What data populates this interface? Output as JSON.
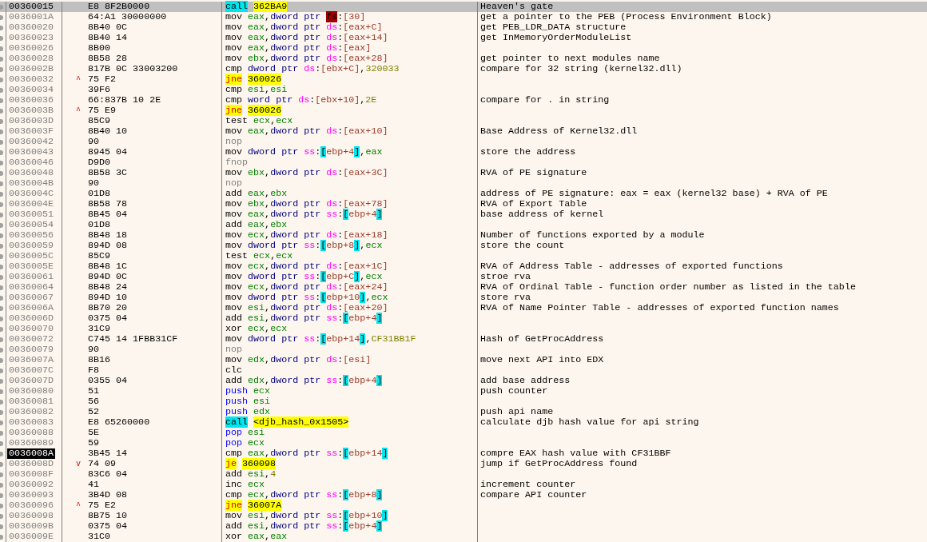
{
  "rows": [
    {
      "address": "00360015",
      "bytes": "E8 8F2B0000",
      "selected": true,
      "current": false,
      "mnemonic": {
        "kind": "call",
        "text": "call"
      },
      "operands": [
        {
          "kind": "target",
          "text": "362BA9"
        }
      ],
      "comment": "Heaven's gate"
    },
    {
      "address": "0036001A",
      "bytes": "64:A1 30000000",
      "selected": false,
      "current": false,
      "mnemonic": {
        "kind": "plain",
        "text": "mov"
      },
      "operands": [
        {
          "kind": "reg",
          "text": "eax"
        },
        {
          "kind": "punct",
          "text": ","
        },
        {
          "kind": "size",
          "text": "dword ptr"
        },
        {
          "kind": "seg_alert",
          "text": "fs"
        },
        {
          "kind": "punct",
          "text": ":"
        },
        {
          "kind": "mem",
          "text": "[30]"
        }
      ],
      "comment": "get a pointer to the PEB (Process Environment Block)"
    },
    {
      "address": "00360020",
      "bytes": "8B40 0C",
      "selected": false,
      "current": false,
      "mnemonic": {
        "kind": "plain",
        "text": "mov"
      },
      "operands": [
        {
          "kind": "reg",
          "text": "eax"
        },
        {
          "kind": "punct",
          "text": ","
        },
        {
          "kind": "size",
          "text": "dword ptr"
        },
        {
          "kind": "seg",
          "text": "ds"
        },
        {
          "kind": "punct",
          "text": ":"
        },
        {
          "kind": "mem",
          "text": "[eax+C]"
        }
      ],
      "comment": "get PEB_LDR_DATA structure"
    },
    {
      "address": "00360023",
      "bytes": "8B40 14",
      "selected": false,
      "current": false,
      "mnemonic": {
        "kind": "plain",
        "text": "mov"
      },
      "operands": [
        {
          "kind": "reg",
          "text": "eax"
        },
        {
          "kind": "punct",
          "text": ","
        },
        {
          "kind": "size",
          "text": "dword ptr"
        },
        {
          "kind": "seg",
          "text": "ds"
        },
        {
          "kind": "punct",
          "text": ":"
        },
        {
          "kind": "mem",
          "text": "[eax+14]"
        }
      ],
      "comment": "get InMemoryOrderModuleList"
    },
    {
      "address": "00360026",
      "bytes": "8B00",
      "selected": false,
      "current": false,
      "mnemonic": {
        "kind": "plain",
        "text": "mov"
      },
      "operands": [
        {
          "kind": "reg",
          "text": "eax"
        },
        {
          "kind": "punct",
          "text": ","
        },
        {
          "kind": "size",
          "text": "dword ptr"
        },
        {
          "kind": "seg",
          "text": "ds"
        },
        {
          "kind": "punct",
          "text": ":"
        },
        {
          "kind": "mem",
          "text": "[eax]"
        }
      ]
    },
    {
      "address": "00360028",
      "bytes": "8B58 28",
      "selected": false,
      "current": false,
      "mnemonic": {
        "kind": "plain",
        "text": "mov"
      },
      "operands": [
        {
          "kind": "reg",
          "text": "ebx"
        },
        {
          "kind": "punct",
          "text": ","
        },
        {
          "kind": "size",
          "text": "dword ptr"
        },
        {
          "kind": "seg",
          "text": "ds"
        },
        {
          "kind": "punct",
          "text": ":"
        },
        {
          "kind": "mem",
          "text": "[eax+28]"
        }
      ],
      "comment": "get pointer to next modules name"
    },
    {
      "address": "0036002B",
      "bytes": "817B 0C 33003200",
      "selected": false,
      "current": false,
      "mnemonic": {
        "kind": "plain",
        "text": "cmp"
      },
      "operands": [
        {
          "kind": "size",
          "text": "dword ptr"
        },
        {
          "kind": "seg",
          "text": "ds"
        },
        {
          "kind": "punct",
          "text": ":"
        },
        {
          "kind": "mem",
          "text": "[ebx+C]"
        },
        {
          "kind": "punct",
          "text": ","
        },
        {
          "kind": "imm",
          "text": "320033"
        }
      ],
      "comment": "compare for 32 string (kernel32.dll)"
    },
    {
      "address": "00360032",
      "arrow": "^",
      "bytes": "75 F2",
      "selected": false,
      "current": false,
      "mnemonic": {
        "kind": "jump",
        "text": "jne"
      },
      "operands": [
        {
          "kind": "target",
          "text": "360026"
        }
      ]
    },
    {
      "address": "00360034",
      "bytes": "39F6",
      "selected": false,
      "current": false,
      "mnemonic": {
        "kind": "plain",
        "text": "cmp"
      },
      "operands": [
        {
          "kind": "reg",
          "text": "esi"
        },
        {
          "kind": "punct",
          "text": ","
        },
        {
          "kind": "reg",
          "text": "esi"
        }
      ]
    },
    {
      "address": "00360036",
      "bytes": "66:837B 10 2E",
      "selected": false,
      "current": false,
      "mnemonic": {
        "kind": "plain",
        "text": "cmp"
      },
      "operands": [
        {
          "kind": "size",
          "text": "word ptr"
        },
        {
          "kind": "seg",
          "text": "ds"
        },
        {
          "kind": "punct",
          "text": ":"
        },
        {
          "kind": "mem",
          "text": "[ebx+10]"
        },
        {
          "kind": "punct",
          "text": ","
        },
        {
          "kind": "imm",
          "text": "2E"
        }
      ],
      "comment": "compare for . in string"
    },
    {
      "address": "0036003B",
      "arrow": "^",
      "bytes": "75 E9",
      "selected": false,
      "current": false,
      "mnemonic": {
        "kind": "jump",
        "text": "jne"
      },
      "operands": [
        {
          "kind": "target",
          "text": "360026"
        }
      ]
    },
    {
      "address": "0036003D",
      "bytes": "85C9",
      "selected": false,
      "current": false,
      "mnemonic": {
        "kind": "plain",
        "text": "test"
      },
      "operands": [
        {
          "kind": "reg",
          "text": "ecx"
        },
        {
          "kind": "punct",
          "text": ","
        },
        {
          "kind": "reg",
          "text": "ecx"
        }
      ]
    },
    {
      "address": "0036003F",
      "bytes": "8B40 10",
      "selected": false,
      "current": false,
      "mnemonic": {
        "kind": "plain",
        "text": "mov"
      },
      "operands": [
        {
          "kind": "reg",
          "text": "eax"
        },
        {
          "kind": "punct",
          "text": ","
        },
        {
          "kind": "size",
          "text": "dword ptr"
        },
        {
          "kind": "seg",
          "text": "ds"
        },
        {
          "kind": "punct",
          "text": ":"
        },
        {
          "kind": "mem",
          "text": "[eax+10]"
        }
      ],
      "comment": "Base Address of Kernel32.dll"
    },
    {
      "address": "00360042",
      "bytes": "90",
      "selected": false,
      "current": false,
      "mnemonic": {
        "kind": "nop",
        "text": "nop"
      },
      "operands": []
    },
    {
      "address": "00360043",
      "bytes": "8945 04",
      "selected": false,
      "current": false,
      "mnemonic": {
        "kind": "plain",
        "text": "mov"
      },
      "operands": [
        {
          "kind": "size",
          "text": "dword ptr"
        },
        {
          "kind": "seg",
          "text": "ss"
        },
        {
          "kind": "punct",
          "text": ":"
        },
        {
          "kind": "bracket",
          "text": "["
        },
        {
          "kind": "mem",
          "text": "ebp+4"
        },
        {
          "kind": "bracket",
          "text": "]"
        },
        {
          "kind": "punct",
          "text": ","
        },
        {
          "kind": "reg",
          "text": "eax"
        }
      ],
      "comment": "store the address"
    },
    {
      "address": "00360046",
      "bytes": "D9D0",
      "selected": false,
      "current": false,
      "mnemonic": {
        "kind": "nop",
        "text": "fnop"
      },
      "operands": []
    },
    {
      "address": "00360048",
      "bytes": "8B58 3C",
      "selected": false,
      "current": false,
      "mnemonic": {
        "kind": "plain",
        "text": "mov"
      },
      "operands": [
        {
          "kind": "reg",
          "text": "ebx"
        },
        {
          "kind": "punct",
          "text": ","
        },
        {
          "kind": "size",
          "text": "dword ptr"
        },
        {
          "kind": "seg",
          "text": "ds"
        },
        {
          "kind": "punct",
          "text": ":"
        },
        {
          "kind": "mem",
          "text": "[eax+3C]"
        }
      ],
      "comment": "RVA of PE signature"
    },
    {
      "address": "0036004B",
      "bytes": "90",
      "selected": false,
      "current": false,
      "mnemonic": {
        "kind": "nop",
        "text": "nop"
      },
      "operands": []
    },
    {
      "address": "0036004C",
      "bytes": "01D8",
      "selected": false,
      "current": false,
      "mnemonic": {
        "kind": "plain",
        "text": "add"
      },
      "operands": [
        {
          "kind": "reg",
          "text": "eax"
        },
        {
          "kind": "punct",
          "text": ","
        },
        {
          "kind": "reg",
          "text": "ebx"
        }
      ],
      "comment": "address of PE signature: eax = eax (kernel32 base) + RVA of PE"
    },
    {
      "address": "0036004E",
      "bytes": "8B58 78",
      "selected": false,
      "current": false,
      "mnemonic": {
        "kind": "plain",
        "text": "mov"
      },
      "operands": [
        {
          "kind": "reg",
          "text": "ebx"
        },
        {
          "kind": "punct",
          "text": ","
        },
        {
          "kind": "size",
          "text": "dword ptr"
        },
        {
          "kind": "seg",
          "text": "ds"
        },
        {
          "kind": "punct",
          "text": ":"
        },
        {
          "kind": "mem",
          "text": "[eax+78]"
        }
      ],
      "comment": "RVA of Export Table"
    },
    {
      "address": "00360051",
      "bytes": "8B45 04",
      "selected": false,
      "current": false,
      "mnemonic": {
        "kind": "plain",
        "text": "mov"
      },
      "operands": [
        {
          "kind": "reg",
          "text": "eax"
        },
        {
          "kind": "punct",
          "text": ","
        },
        {
          "kind": "size",
          "text": "dword ptr"
        },
        {
          "kind": "seg",
          "text": "ss"
        },
        {
          "kind": "punct",
          "text": ":"
        },
        {
          "kind": "bracket",
          "text": "["
        },
        {
          "kind": "mem",
          "text": "ebp+4"
        },
        {
          "kind": "bracket",
          "text": "]"
        }
      ],
      "comment": "base address of kernel"
    },
    {
      "address": "00360054",
      "bytes": "01D8",
      "selected": false,
      "current": false,
      "mnemonic": {
        "kind": "plain",
        "text": "add"
      },
      "operands": [
        {
          "kind": "reg",
          "text": "eax"
        },
        {
          "kind": "punct",
          "text": ","
        },
        {
          "kind": "reg",
          "text": "ebx"
        }
      ]
    },
    {
      "address": "00360056",
      "bytes": "8B48 18",
      "selected": false,
      "current": false,
      "mnemonic": {
        "kind": "plain",
        "text": "mov"
      },
      "operands": [
        {
          "kind": "reg",
          "text": "ecx"
        },
        {
          "kind": "punct",
          "text": ","
        },
        {
          "kind": "size",
          "text": "dword ptr"
        },
        {
          "kind": "seg",
          "text": "ds"
        },
        {
          "kind": "punct",
          "text": ":"
        },
        {
          "kind": "mem",
          "text": "[eax+18]"
        }
      ],
      "comment": "Number of functions exported by a module"
    },
    {
      "address": "00360059",
      "bytes": "894D 08",
      "selected": false,
      "current": false,
      "mnemonic": {
        "kind": "plain",
        "text": "mov"
      },
      "operands": [
        {
          "kind": "size",
          "text": "dword ptr"
        },
        {
          "kind": "seg",
          "text": "ss"
        },
        {
          "kind": "punct",
          "text": ":"
        },
        {
          "kind": "bracket",
          "text": "["
        },
        {
          "kind": "mem",
          "text": "ebp+8"
        },
        {
          "kind": "bracket",
          "text": "]"
        },
        {
          "kind": "punct",
          "text": ","
        },
        {
          "kind": "reg",
          "text": "ecx"
        }
      ],
      "comment": "store the count"
    },
    {
      "address": "0036005C",
      "bytes": "85C9",
      "selected": false,
      "current": false,
      "mnemonic": {
        "kind": "plain",
        "text": "test"
      },
      "operands": [
        {
          "kind": "reg",
          "text": "ecx"
        },
        {
          "kind": "punct",
          "text": ","
        },
        {
          "kind": "reg",
          "text": "ecx"
        }
      ]
    },
    {
      "address": "0036005E",
      "bytes": "8B48 1C",
      "selected": false,
      "current": false,
      "mnemonic": {
        "kind": "plain",
        "text": "mov"
      },
      "operands": [
        {
          "kind": "reg",
          "text": "ecx"
        },
        {
          "kind": "punct",
          "text": ","
        },
        {
          "kind": "size",
          "text": "dword ptr"
        },
        {
          "kind": "seg",
          "text": "ds"
        },
        {
          "kind": "punct",
          "text": ":"
        },
        {
          "kind": "mem",
          "text": "[eax+1C]"
        }
      ],
      "comment": "RVA of Address Table - addresses of exported functions"
    },
    {
      "address": "00360061",
      "bytes": "894D 0C",
      "selected": false,
      "current": false,
      "mnemonic": {
        "kind": "plain",
        "text": "mov"
      },
      "operands": [
        {
          "kind": "size",
          "text": "dword ptr"
        },
        {
          "kind": "seg",
          "text": "ss"
        },
        {
          "kind": "punct",
          "text": ":"
        },
        {
          "kind": "bracket",
          "text": "["
        },
        {
          "kind": "mem",
          "text": "ebp+C"
        },
        {
          "kind": "bracket",
          "text": "]"
        },
        {
          "kind": "punct",
          "text": ","
        },
        {
          "kind": "reg",
          "text": "ecx"
        }
      ],
      "comment": "stroe rva"
    },
    {
      "address": "00360064",
      "bytes": "8B48 24",
      "selected": false,
      "current": false,
      "mnemonic": {
        "kind": "plain",
        "text": "mov"
      },
      "operands": [
        {
          "kind": "reg",
          "text": "ecx"
        },
        {
          "kind": "punct",
          "text": ","
        },
        {
          "kind": "size",
          "text": "dword ptr"
        },
        {
          "kind": "seg",
          "text": "ds"
        },
        {
          "kind": "punct",
          "text": ":"
        },
        {
          "kind": "mem",
          "text": "[eax+24]"
        }
      ],
      "comment": "RVA of Ordinal Table - function order number as listed in the table"
    },
    {
      "address": "00360067",
      "bytes": "894D 10",
      "selected": false,
      "current": false,
      "mnemonic": {
        "kind": "plain",
        "text": "mov"
      },
      "operands": [
        {
          "kind": "size",
          "text": "dword ptr"
        },
        {
          "kind": "seg",
          "text": "ss"
        },
        {
          "kind": "punct",
          "text": ":"
        },
        {
          "kind": "bracket",
          "text": "["
        },
        {
          "kind": "mem",
          "text": "ebp+10"
        },
        {
          "kind": "bracket",
          "text": "]"
        },
        {
          "kind": "punct",
          "text": ","
        },
        {
          "kind": "reg",
          "text": "ecx"
        }
      ],
      "comment": "store rva"
    },
    {
      "address": "0036006A",
      "bytes": "8B70 20",
      "selected": false,
      "current": false,
      "mnemonic": {
        "kind": "plain",
        "text": "mov"
      },
      "operands": [
        {
          "kind": "reg",
          "text": "esi"
        },
        {
          "kind": "punct",
          "text": ","
        },
        {
          "kind": "size",
          "text": "dword ptr"
        },
        {
          "kind": "seg",
          "text": "ds"
        },
        {
          "kind": "punct",
          "text": ":"
        },
        {
          "kind": "mem",
          "text": "[eax+20]"
        }
      ],
      "comment": "RVA of Name Pointer Table - addresses of exported function names"
    },
    {
      "address": "0036006D",
      "bytes": "0375 04",
      "selected": false,
      "current": false,
      "mnemonic": {
        "kind": "plain",
        "text": "add"
      },
      "operands": [
        {
          "kind": "reg",
          "text": "esi"
        },
        {
          "kind": "punct",
          "text": ","
        },
        {
          "kind": "size",
          "text": "dword ptr"
        },
        {
          "kind": "seg",
          "text": "ss"
        },
        {
          "kind": "punct",
          "text": ":"
        },
        {
          "kind": "bracket",
          "text": "["
        },
        {
          "kind": "mem",
          "text": "ebp+4"
        },
        {
          "kind": "bracket",
          "text": "]"
        }
      ]
    },
    {
      "address": "00360070",
      "bytes": "31C9",
      "selected": false,
      "current": false,
      "mnemonic": {
        "kind": "plain",
        "text": "xor"
      },
      "operands": [
        {
          "kind": "reg",
          "text": "ecx"
        },
        {
          "kind": "punct",
          "text": ","
        },
        {
          "kind": "reg",
          "text": "ecx"
        }
      ]
    },
    {
      "address": "00360072",
      "bytes": "C745 14 1FBB31CF",
      "selected": false,
      "current": false,
      "mnemonic": {
        "kind": "plain",
        "text": "mov"
      },
      "operands": [
        {
          "kind": "size",
          "text": "dword ptr"
        },
        {
          "kind": "seg",
          "text": "ss"
        },
        {
          "kind": "punct",
          "text": ":"
        },
        {
          "kind": "bracket",
          "text": "["
        },
        {
          "kind": "mem",
          "text": "ebp+14"
        },
        {
          "kind": "bracket",
          "text": "]"
        },
        {
          "kind": "punct",
          "text": ","
        },
        {
          "kind": "imm",
          "text": "CF31BB1F"
        }
      ],
      "comment": "Hash of GetProcAddress"
    },
    {
      "address": "00360079",
      "bytes": "90",
      "selected": false,
      "current": false,
      "mnemonic": {
        "kind": "nop",
        "text": "nop"
      },
      "operands": []
    },
    {
      "address": "0036007A",
      "bytes": "8B16",
      "selected": false,
      "current": false,
      "mnemonic": {
        "kind": "plain",
        "text": "mov"
      },
      "operands": [
        {
          "kind": "reg",
          "text": "edx"
        },
        {
          "kind": "punct",
          "text": ","
        },
        {
          "kind": "size",
          "text": "dword ptr"
        },
        {
          "kind": "seg",
          "text": "ds"
        },
        {
          "kind": "punct",
          "text": ":"
        },
        {
          "kind": "mem",
          "text": "[esi]"
        }
      ],
      "comment": "move next API into EDX"
    },
    {
      "address": "0036007C",
      "bytes": "F8",
      "selected": false,
      "current": false,
      "mnemonic": {
        "kind": "plain",
        "text": "clc"
      },
      "operands": []
    },
    {
      "address": "0036007D",
      "bytes": "0355 04",
      "selected": false,
      "current": false,
      "mnemonic": {
        "kind": "plain",
        "text": "add"
      },
      "operands": [
        {
          "kind": "reg",
          "text": "edx"
        },
        {
          "kind": "punct",
          "text": ","
        },
        {
          "kind": "size",
          "text": "dword ptr"
        },
        {
          "kind": "seg",
          "text": "ss"
        },
        {
          "kind": "punct",
          "text": ":"
        },
        {
          "kind": "bracket",
          "text": "["
        },
        {
          "kind": "mem",
          "text": "ebp+4"
        },
        {
          "kind": "bracket",
          "text": "]"
        }
      ],
      "comment": "add base address"
    },
    {
      "address": "00360080",
      "bytes": "51",
      "selected": false,
      "current": false,
      "mnemonic": {
        "kind": "stack",
        "text": "push"
      },
      "operands": [
        {
          "kind": "reg",
          "text": "ecx"
        }
      ],
      "comment": "push counter"
    },
    {
      "address": "00360081",
      "bytes": "56",
      "selected": false,
      "current": false,
      "mnemonic": {
        "kind": "stack",
        "text": "push"
      },
      "operands": [
        {
          "kind": "reg",
          "text": "esi"
        }
      ]
    },
    {
      "address": "00360082",
      "bytes": "52",
      "selected": false,
      "current": false,
      "mnemonic": {
        "kind": "stack",
        "text": "push"
      },
      "operands": [
        {
          "kind": "reg",
          "text": "edx"
        }
      ],
      "comment": "push api name"
    },
    {
      "address": "00360083",
      "bytes": "E8 65260000",
      "selected": false,
      "current": false,
      "mnemonic": {
        "kind": "call",
        "text": "call"
      },
      "operands": [
        {
          "kind": "target",
          "text": "<djb_hash_0x1505>"
        }
      ],
      "comment": "calculate djb hash value for api string"
    },
    {
      "address": "00360088",
      "bytes": "5E",
      "selected": false,
      "current": false,
      "mnemonic": {
        "kind": "stack",
        "text": "pop"
      },
      "operands": [
        {
          "kind": "reg",
          "text": "esi"
        }
      ]
    },
    {
      "address": "00360089",
      "bytes": "59",
      "selected": false,
      "current": false,
      "mnemonic": {
        "kind": "stack",
        "text": "pop"
      },
      "operands": [
        {
          "kind": "reg",
          "text": "ecx"
        }
      ]
    },
    {
      "address": "0036008A",
      "bytes": "3B45 14",
      "selected": false,
      "current": true,
      "mnemonic": {
        "kind": "plain",
        "text": "cmp"
      },
      "operands": [
        {
          "kind": "reg",
          "text": "eax"
        },
        {
          "kind": "punct",
          "text": ","
        },
        {
          "kind": "size",
          "text": "dword ptr"
        },
        {
          "kind": "seg",
          "text": "ss"
        },
        {
          "kind": "punct",
          "text": ":"
        },
        {
          "kind": "bracket",
          "text": "["
        },
        {
          "kind": "mem",
          "text": "ebp+14"
        },
        {
          "kind": "bracket",
          "text": "]"
        }
      ],
      "comment": "compre EAX hash value with CF31BBF"
    },
    {
      "address": "0036008D",
      "arrow": "v",
      "bytes": "74 09",
      "selected": false,
      "current": false,
      "mnemonic": {
        "kind": "jump",
        "text": "je"
      },
      "operands": [
        {
          "kind": "target",
          "text": "360098"
        }
      ],
      "comment": "jump if GetProcAddress found"
    },
    {
      "address": "0036008F",
      "bytes": "83C6 04",
      "selected": false,
      "current": false,
      "mnemonic": {
        "kind": "plain",
        "text": "add"
      },
      "operands": [
        {
          "kind": "reg",
          "text": "esi"
        },
        {
          "kind": "punct",
          "text": ","
        },
        {
          "kind": "imm",
          "text": "4"
        }
      ]
    },
    {
      "address": "00360092",
      "bytes": "41",
      "selected": false,
      "current": false,
      "mnemonic": {
        "kind": "plain",
        "text": "inc"
      },
      "operands": [
        {
          "kind": "reg",
          "text": "ecx"
        }
      ],
      "comment": "increment counter"
    },
    {
      "address": "00360093",
      "bytes": "3B4D 08",
      "selected": false,
      "current": false,
      "mnemonic": {
        "kind": "plain",
        "text": "cmp"
      },
      "operands": [
        {
          "kind": "reg",
          "text": "ecx"
        },
        {
          "kind": "punct",
          "text": ","
        },
        {
          "kind": "size",
          "text": "dword ptr"
        },
        {
          "kind": "seg",
          "text": "ss"
        },
        {
          "kind": "punct",
          "text": ":"
        },
        {
          "kind": "bracket",
          "text": "["
        },
        {
          "kind": "mem",
          "text": "ebp+8"
        },
        {
          "kind": "bracket",
          "text": "]"
        }
      ],
      "comment": "compare API counter"
    },
    {
      "address": "00360096",
      "arrow": "^",
      "bytes": "75 E2",
      "selected": false,
      "current": false,
      "mnemonic": {
        "kind": "jump",
        "text": "jne"
      },
      "operands": [
        {
          "kind": "target",
          "text": "36007A"
        }
      ]
    },
    {
      "address": "00360098",
      "bytes": "8B75 10",
      "selected": false,
      "current": false,
      "mnemonic": {
        "kind": "plain",
        "text": "mov"
      },
      "operands": [
        {
          "kind": "reg",
          "text": "esi"
        },
        {
          "kind": "punct",
          "text": ","
        },
        {
          "kind": "size",
          "text": "dword ptr"
        },
        {
          "kind": "seg",
          "text": "ss"
        },
        {
          "kind": "punct",
          "text": ":"
        },
        {
          "kind": "bracket",
          "text": "["
        },
        {
          "kind": "mem",
          "text": "ebp+10"
        },
        {
          "kind": "bracket",
          "text": "]"
        }
      ]
    },
    {
      "address": "0036009B",
      "bytes": "0375 04",
      "selected": false,
      "current": false,
      "mnemonic": {
        "kind": "plain",
        "text": "add"
      },
      "operands": [
        {
          "kind": "reg",
          "text": "esi"
        },
        {
          "kind": "punct",
          "text": ","
        },
        {
          "kind": "size",
          "text": "dword ptr"
        },
        {
          "kind": "seg",
          "text": "ss"
        },
        {
          "kind": "punct",
          "text": ":"
        },
        {
          "kind": "bracket",
          "text": "["
        },
        {
          "kind": "mem",
          "text": "ebp+4"
        },
        {
          "kind": "bracket",
          "text": "]"
        }
      ]
    },
    {
      "address": "0036009E",
      "bytes": "31C0",
      "selected": false,
      "current": false,
      "mnemonic": {
        "kind": "plain",
        "text": "xor"
      },
      "operands": [
        {
          "kind": "reg",
          "text": "eax"
        },
        {
          "kind": "punct",
          "text": ","
        },
        {
          "kind": "reg",
          "text": "eax"
        }
      ]
    }
  ]
}
